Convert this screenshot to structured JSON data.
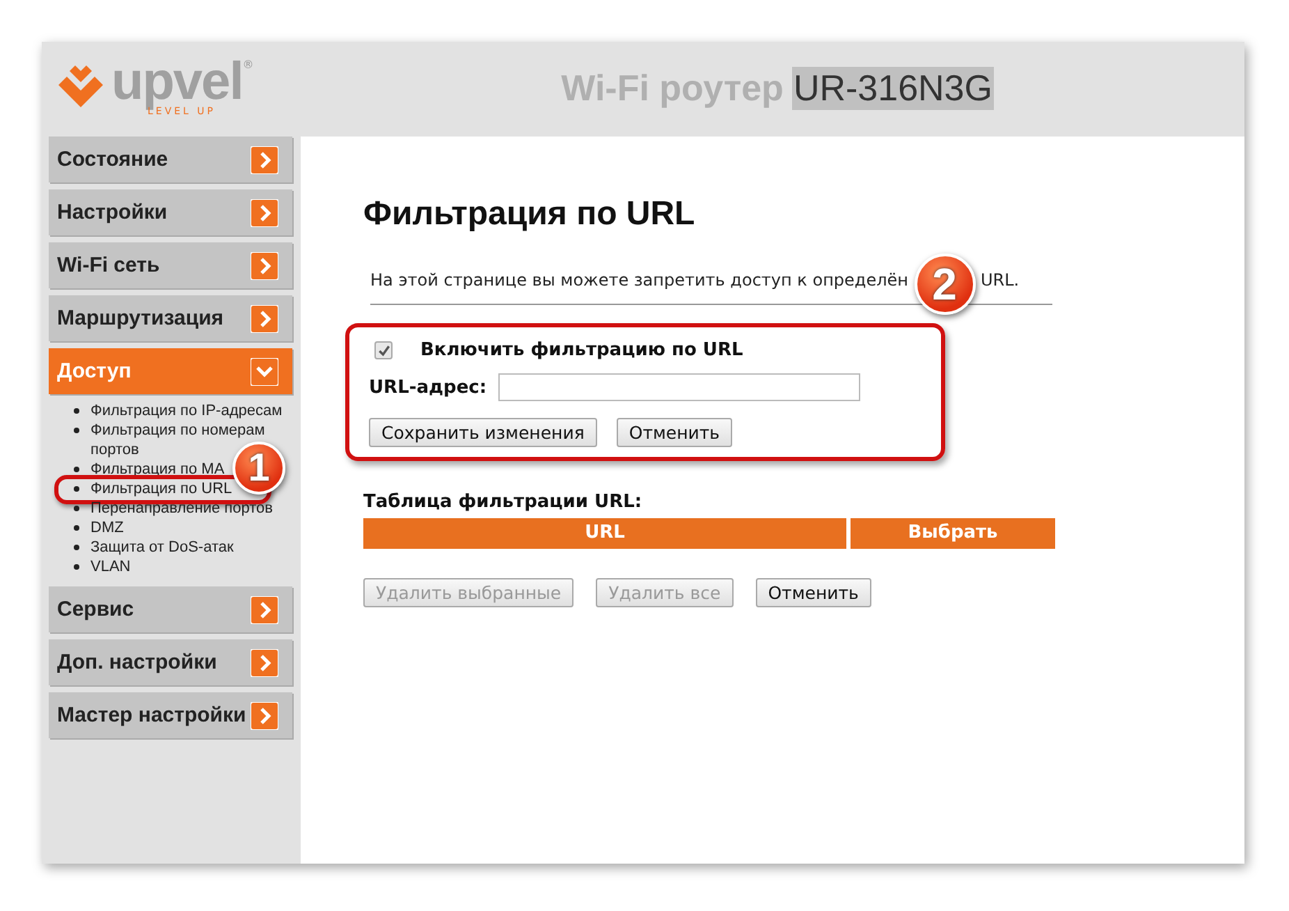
{
  "header": {
    "logo_text": "upvel",
    "logo_tagline": "LEVEL UP",
    "logo_mark": "®",
    "title": "Wi-Fi роутер",
    "model": "UR-316N3G"
  },
  "sidebar": {
    "items": [
      {
        "label": "Состояние",
        "expanded": false
      },
      {
        "label": "Настройки",
        "expanded": false
      },
      {
        "label": "Wi-Fi сеть",
        "expanded": false
      },
      {
        "label": "Маршрутизация",
        "expanded": false
      },
      {
        "label": "Доступ",
        "expanded": true,
        "children": [
          {
            "label": "Фильтрация по IP-адресам",
            "annotated": false
          },
          {
            "label": "Фильтрация по номерам портов",
            "annotated": false
          },
          {
            "label": "Фильтрация по MA",
            "annotated": false
          },
          {
            "label": "Фильтрация по URL",
            "annotated": true
          },
          {
            "label": "Перенаправление портов",
            "annotated": false
          },
          {
            "label": "DMZ",
            "annotated": false
          },
          {
            "label": "Защита от DoS-атак",
            "annotated": false
          },
          {
            "label": "VLAN",
            "annotated": false
          }
        ]
      },
      {
        "label": "Сервис",
        "expanded": false
      },
      {
        "label": "Доп. настройки",
        "expanded": false
      },
      {
        "label": "Мастер настройки",
        "expanded": false
      }
    ],
    "badge": "1"
  },
  "content": {
    "title": "Фильтрация по URL",
    "description_start": "На этой странице вы можете запретить доступ к определён",
    "description_end": "URL.",
    "badge": "2",
    "form": {
      "enable_label": "Включить фильтрацию по URL",
      "enable_checked": true,
      "url_label": "URL-адрес:",
      "buttons": [
        {
          "label": "Сохранить изменения",
          "disabled": false
        },
        {
          "label": "Отменить",
          "disabled": false
        }
      ]
    },
    "table": {
      "title": "Таблица фильтрации URL:",
      "columns": [
        "URL",
        "Выбрать"
      ]
    },
    "buttons": [
      {
        "label": "Удалить выбранные",
        "disabled": true
      },
      {
        "label": "Удалить все",
        "disabled": true
      },
      {
        "label": "Отменить",
        "disabled": false
      }
    ]
  }
}
